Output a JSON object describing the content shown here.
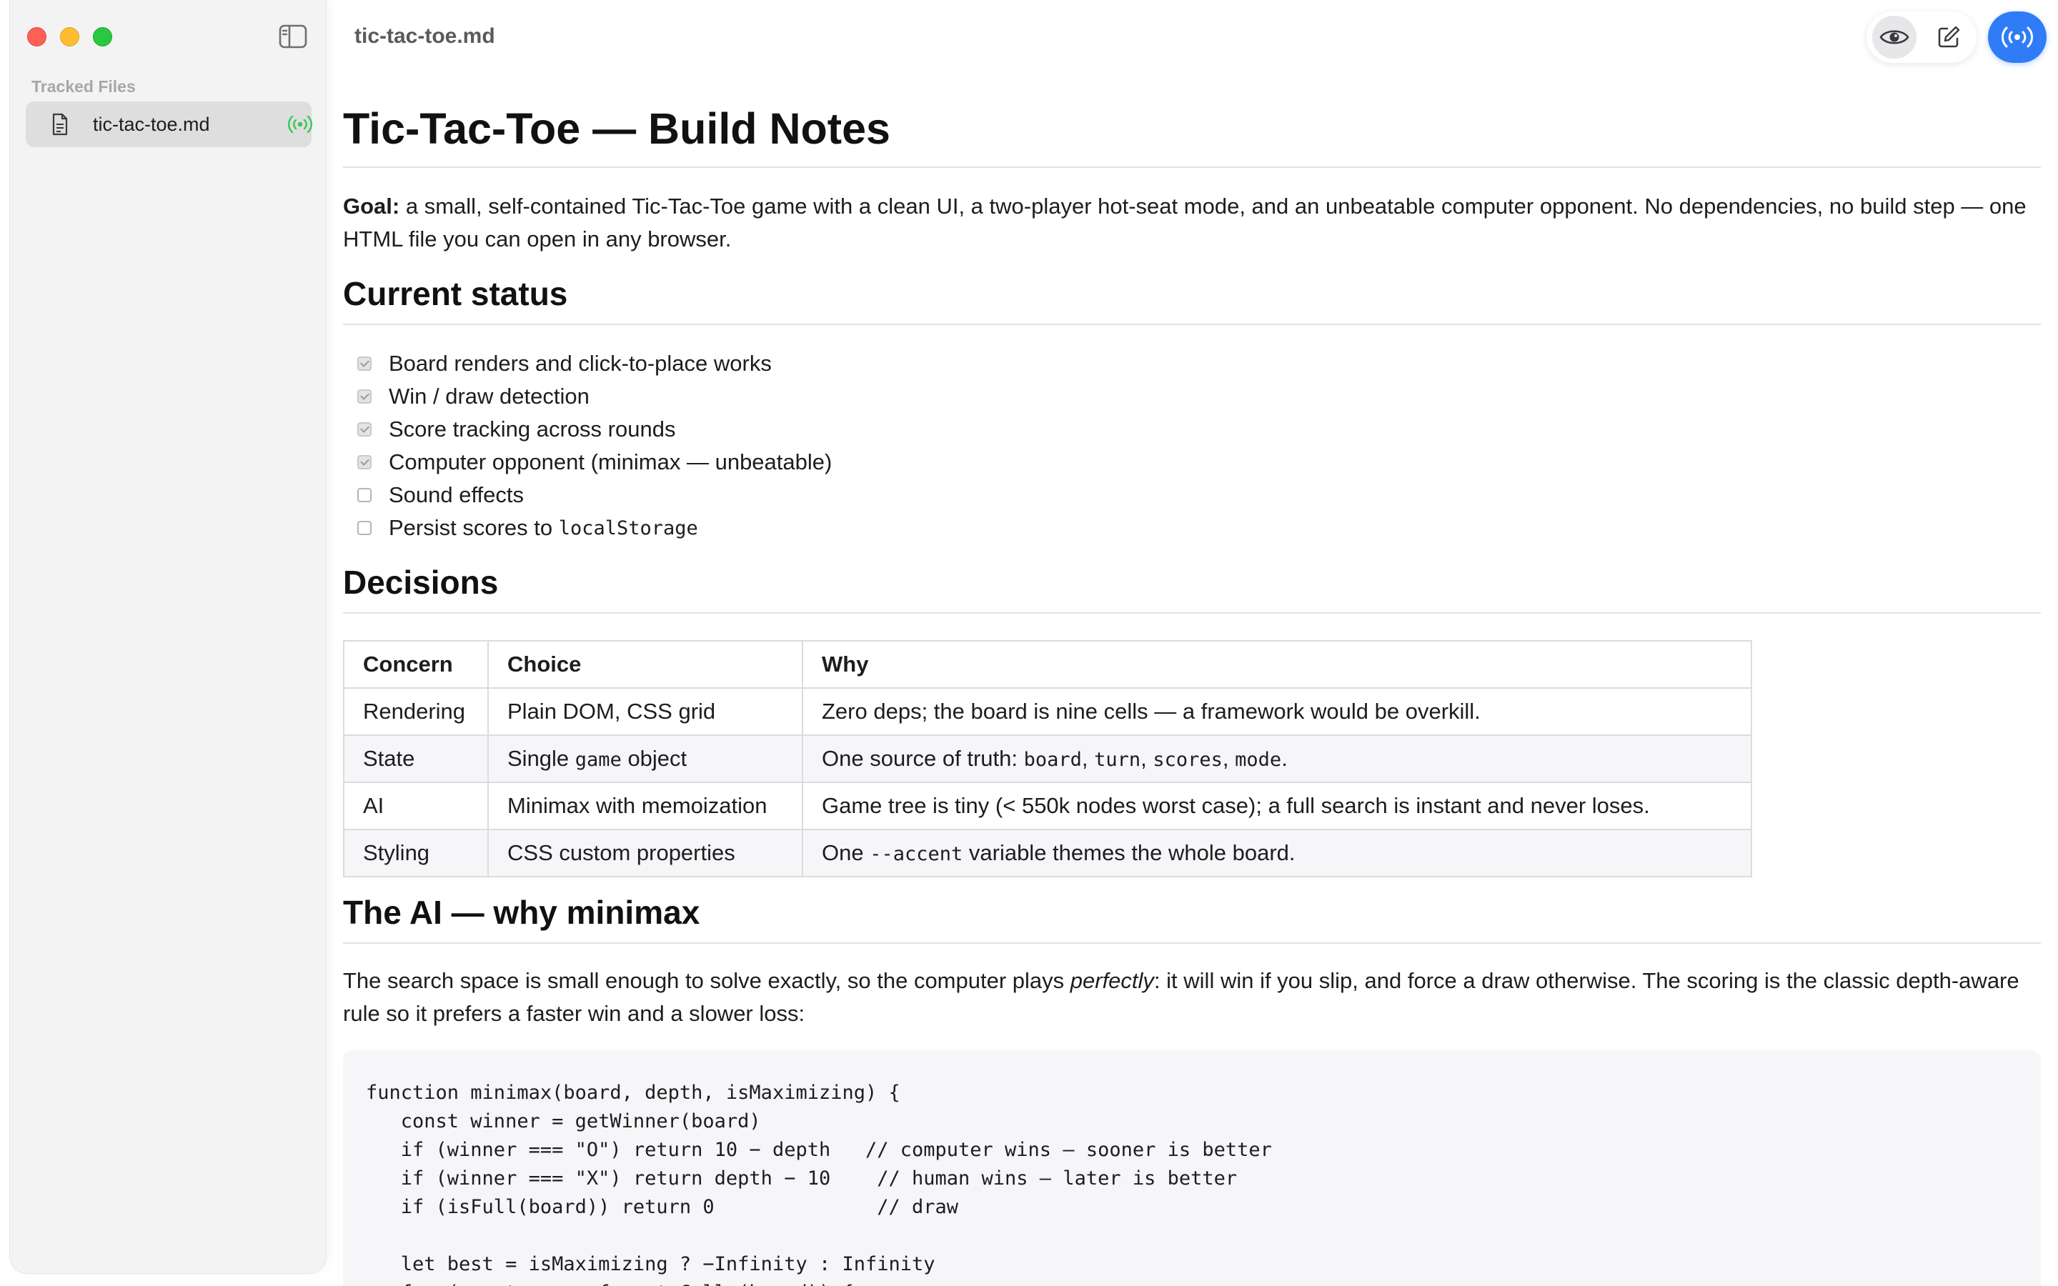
{
  "sidebar": {
    "section_label": "Tracked Files",
    "files": [
      {
        "name": "tic-tac-toe.md",
        "status_icon": "live-broadcast-icon",
        "status_color": "#34c759"
      }
    ]
  },
  "titlebar": {
    "title": "tic-tac-toe.md",
    "accent": "#2f7cf6"
  },
  "doc": {
    "h1": "Tic-Tac-Toe — Build Notes",
    "goal_label": "Goal:",
    "goal_text": " a small, self-contained Tic-Tac-Toe game with a clean UI, a two-player hot-seat mode, and an unbeatable computer opponent. No dependencies, no build step — one HTML file you can open in any browser.",
    "status_heading": "Current status",
    "tasks": [
      {
        "text": "Board renders and click-to-place works",
        "checked": true
      },
      {
        "text": "Win / draw detection",
        "checked": true
      },
      {
        "text": "Score tracking across rounds",
        "checked": true
      },
      {
        "text": "Computer opponent (minimax — unbeatable)",
        "checked": true
      },
      {
        "text": "Sound effects",
        "checked": false
      },
      {
        "text": "Persist scores to ",
        "code": "localStorage",
        "checked": false
      }
    ],
    "decisions_heading": "Decisions",
    "table": {
      "headers": [
        "Concern",
        "Choice",
        "Why"
      ],
      "rows": {
        "r0": {
          "concern": "Rendering",
          "choice": "Plain DOM, CSS grid",
          "why": "Zero deps; the board is nine cells — a framework would be overkill."
        },
        "r1": {
          "concern": "State",
          "choice_pre": "Single ",
          "choice_code": "game",
          "choice_post": " object",
          "why_pre": "One source of truth: ",
          "why_c1": "board",
          "why_c2": "turn",
          "why_c3": "scores",
          "why_c4": "mode",
          "sep": ", ",
          "end": "."
        },
        "r2": {
          "concern": "AI",
          "choice": "Minimax with memoization",
          "why": "Game tree is tiny (< 550k nodes worst case); a full search is instant and never loses."
        },
        "r3": {
          "concern": "Styling",
          "choice": "CSS custom properties",
          "why_pre": "One ",
          "why_code": "--accent",
          "why_post": " variable themes the whole board."
        }
      }
    },
    "ai_heading": "The AI — why minimax",
    "ai_para_pre": "The search space is small enough to solve exactly, so the computer plays ",
    "ai_para_em": "perfectly",
    "ai_para_post": ": it will win if you slip, and force a draw otherwise. The scoring is the classic depth-aware rule so it prefers a faster win and a slower loss:",
    "code": "function minimax(board, depth, isMaximizing) {\n   const winner = getWinner(board)\n   if (winner === \"O\") return 10 − depth   // computer wins — sooner is better\n   if (winner === \"X\") return depth − 10    // human wins — later is better\n   if (isFull(board)) return 0              // draw\n\n   let best = isMaximizing ? −Infinity : Infinity\n   for (const move of emptyCells(board)) {"
  }
}
